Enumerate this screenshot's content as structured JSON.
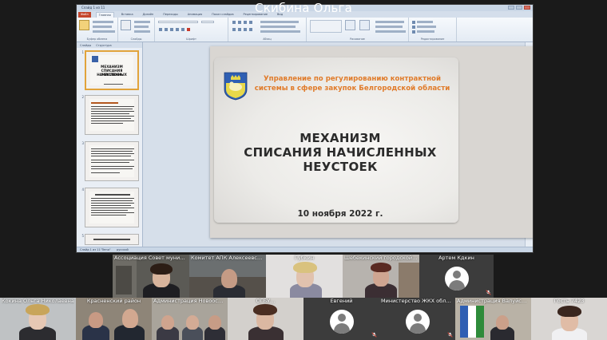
{
  "presenter": {
    "name": "Скибина Ольга"
  },
  "powerpoint": {
    "window_title": "Слайд 1 из 11",
    "tabs": [
      "Файл",
      "Главная",
      "Вставка",
      "Дизайн",
      "Переходы",
      "Анимация",
      "Показ слайдов",
      "Рецензирование",
      "Вид"
    ],
    "ribbon_groups": [
      "Буфер обмена",
      "Слайды",
      "Шрифт",
      "Абзац",
      "Рисование",
      "Редактирование"
    ],
    "panel_tabs": [
      "Слайды",
      "Структура"
    ],
    "status_left": "Слайд 1 из 11",
    "status_theme": "\"Tema\"",
    "status_lang": "русский"
  },
  "slide": {
    "org_line1": "Управление по регулированию контрактной",
    "org_line2": "системы в сфере закупок Белгородской области",
    "title_line1": "МЕХАНИЗМ",
    "title_line2": "СПИСАНИЯ НАЧИСЛЕННЫХ",
    "title_line3": "НЕУСТОЕК",
    "date": "10 ноября 2022 г."
  },
  "thumbnails": [
    {
      "num": "1",
      "line1": "МЕХАНИЗМ",
      "line2": "СПИСАНИЯ НАЧИСЛЕННЫХ",
      "line3": "НЕУСТОЕК"
    },
    {
      "num": "2"
    },
    {
      "num": "3"
    },
    {
      "num": "4"
    },
    {
      "num": "5"
    }
  ],
  "participants_row1": [
    {
      "name": "Ассоциация Совет муници..."
    },
    {
      "name": "Комитет АПК Алексеевск..."
    },
    {
      "name": "Губкин"
    },
    {
      "name": "Шебекинский городской о..."
    },
    {
      "name": "Артем Кдкин"
    }
  ],
  "participants_row2": [
    {
      "name": "Кокина Ольга Николаевна"
    },
    {
      "name": "Красненский район"
    },
    {
      "name": "Администрация Новоосколь..."
    },
    {
      "name": "ОГБУ..."
    },
    {
      "name": "Евгений"
    },
    {
      "name": "Министерство ЖКХ области"
    },
    {
      "name": "Администрация Валуйского..."
    },
    {
      "name": "Гость 7423"
    }
  ],
  "colors": {
    "org_text": "#e07b2a",
    "title_text": "#2b2b2b",
    "file_tab": "#c4462c",
    "thumb_highlight": "#e1a33a",
    "mic_off": "#e74c3c"
  }
}
